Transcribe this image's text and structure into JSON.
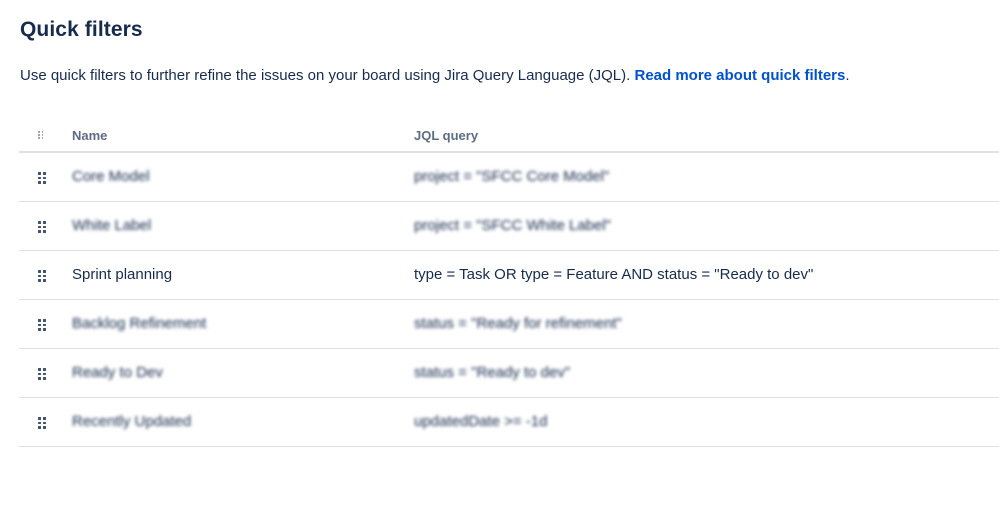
{
  "page": {
    "title": "Quick filters",
    "intro_text": "Use quick filters to further refine the issues on your board using Jira Query Language (JQL). ",
    "intro_link": "Read more about quick filters",
    "intro_end": "."
  },
  "table": {
    "columns": {
      "name": "Name",
      "jql": "JQL query"
    },
    "rows": [
      {
        "name": "Core Model",
        "jql": "project = \"SFCC Core Model\"",
        "blurred": true
      },
      {
        "name": "White Label",
        "jql": "project = \"SFCC White Label\"",
        "blurred": true
      },
      {
        "name": "Sprint planning",
        "jql": "type = Task OR type = Feature AND status = \"Ready to dev\"",
        "blurred": false
      },
      {
        "name": "Backlog Refinement",
        "jql": "status = \"Ready for refinement\"",
        "blurred": true
      },
      {
        "name": "Ready to Dev",
        "jql": "status = \"Ready to dev\"",
        "blurred": true
      },
      {
        "name": "Recently Updated",
        "jql": "updatedDate >= -1d",
        "blurred": true
      }
    ]
  },
  "icons": {
    "drag_handle": "drag-handle-icon"
  },
  "colors": {
    "text": "#172b4d",
    "link": "#0052cc",
    "header_text": "#5e6c84",
    "border": "#dfe1e6"
  }
}
